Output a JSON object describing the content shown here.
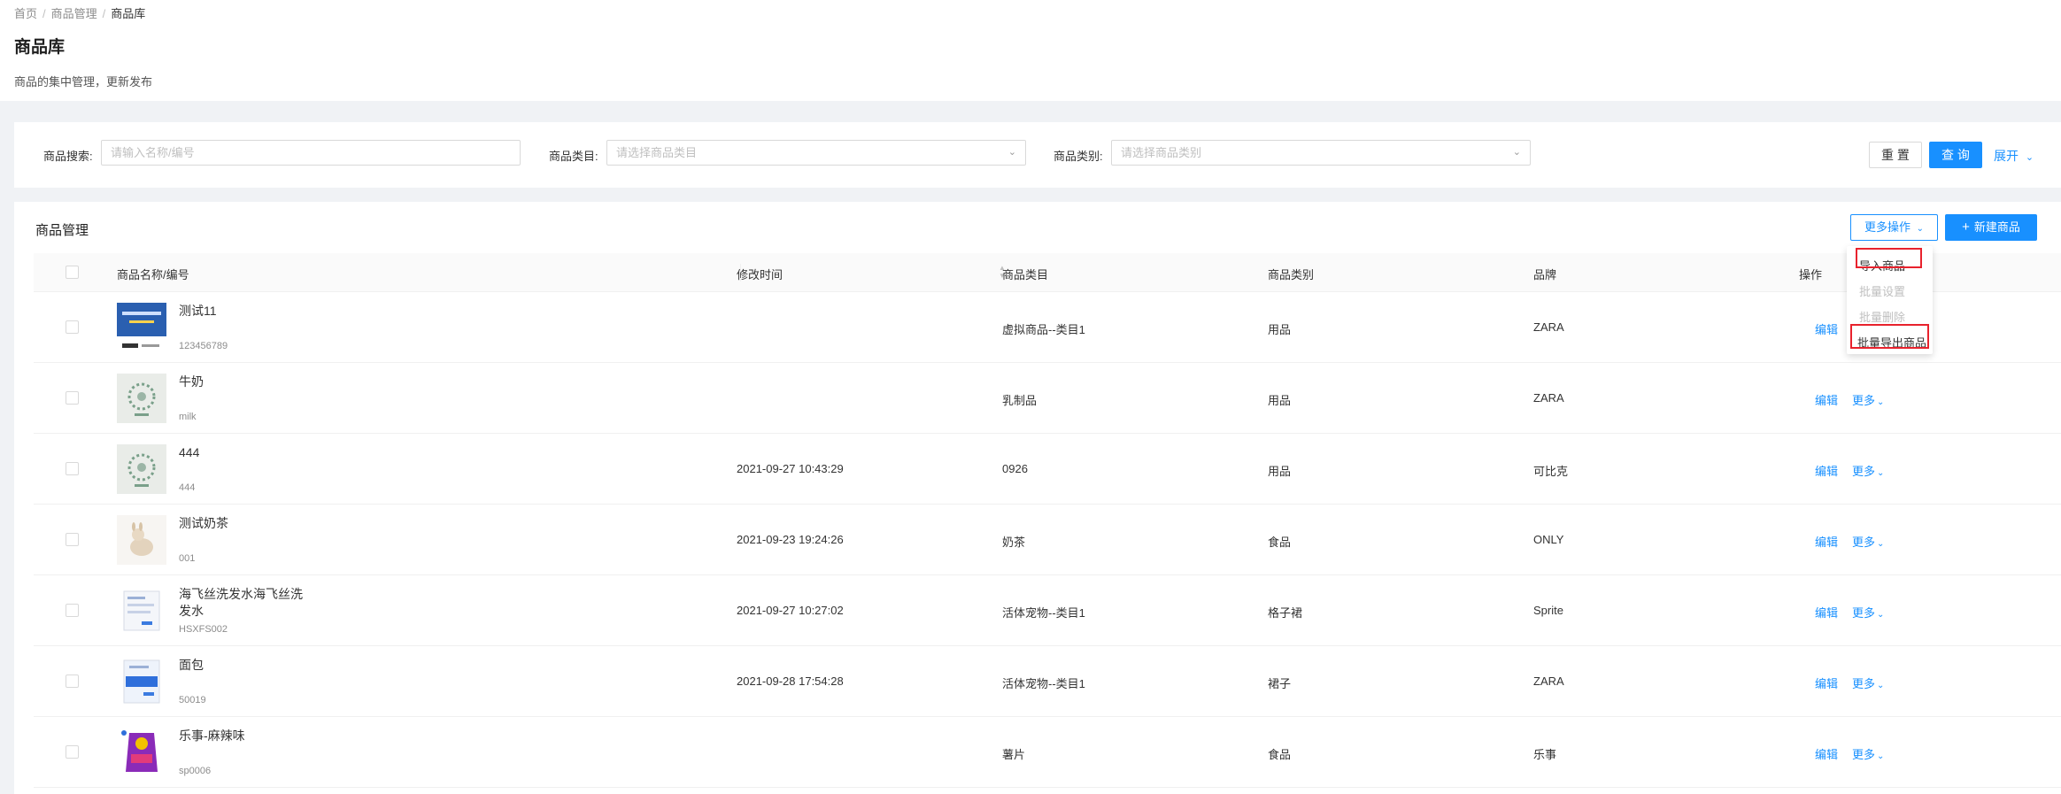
{
  "breadcrumb": {
    "home": "首页",
    "sep": "/",
    "parent": "商品管理",
    "current": "商品库"
  },
  "page": {
    "title": "商品库",
    "description": "商品的集中管理，更新发布"
  },
  "filters": {
    "search": {
      "label": "商品搜索:",
      "placeholder": "请输入名称/编号"
    },
    "category": {
      "label": "商品类目:",
      "placeholder": "请选择商品类目"
    },
    "type": {
      "label": "商品类别:",
      "placeholder": "请选择商品类别"
    },
    "reset": "重 置",
    "query": "查 询",
    "expand": "展开"
  },
  "table": {
    "title": "商品管理",
    "more_ops": "更多操作",
    "new_button": "新建商品",
    "headers": {
      "name": "商品名称/编号",
      "time": "修改时间",
      "category": "商品类目",
      "type": "商品类别",
      "brand": "品牌",
      "ops": "操作"
    },
    "edit_label": "编辑",
    "more_label": "更多",
    "rows": [
      {
        "name": "测试11",
        "code": "123456789",
        "time": "",
        "category": "虚拟商品--类目1",
        "type": "用品",
        "brand": "ZARA"
      },
      {
        "name": "牛奶",
        "code": "milk",
        "time": "",
        "category": "乳制品",
        "type": "用品",
        "brand": "ZARA"
      },
      {
        "name": "444",
        "code": "444",
        "time": "2021-09-27 10:43:29",
        "category": "0926",
        "type": "用品",
        "brand": "可比克"
      },
      {
        "name": "测试奶茶",
        "code": "001",
        "time": "2021-09-23 19:24:26",
        "category": "奶茶",
        "type": "食品",
        "brand": "ONLY"
      },
      {
        "name": "海飞丝洗发水海飞丝洗发水",
        "code": "HSXFS002",
        "time": "2021-09-27 10:27:02",
        "category": "活体宠物--类目1",
        "type": "格子裙",
        "brand": "Sprite"
      },
      {
        "name": "面包",
        "code": "50019",
        "time": "2021-09-28 17:54:28",
        "category": "活体宠物--类目1",
        "type": "裙子",
        "brand": "ZARA"
      },
      {
        "name": "乐事-麻辣味",
        "code": "sp0006",
        "time": "",
        "category": "薯片",
        "type": "食品",
        "brand": "乐事"
      }
    ]
  },
  "dropdown": {
    "items": [
      {
        "label": "导入商品",
        "enabled": true
      },
      {
        "label": "批量设置",
        "enabled": false
      },
      {
        "label": "批量删除",
        "enabled": false
      },
      {
        "label": "批量导出商品",
        "enabled": true
      }
    ]
  },
  "colors": {
    "primary": "#1890ff",
    "highlight_box": "#e8222d"
  }
}
